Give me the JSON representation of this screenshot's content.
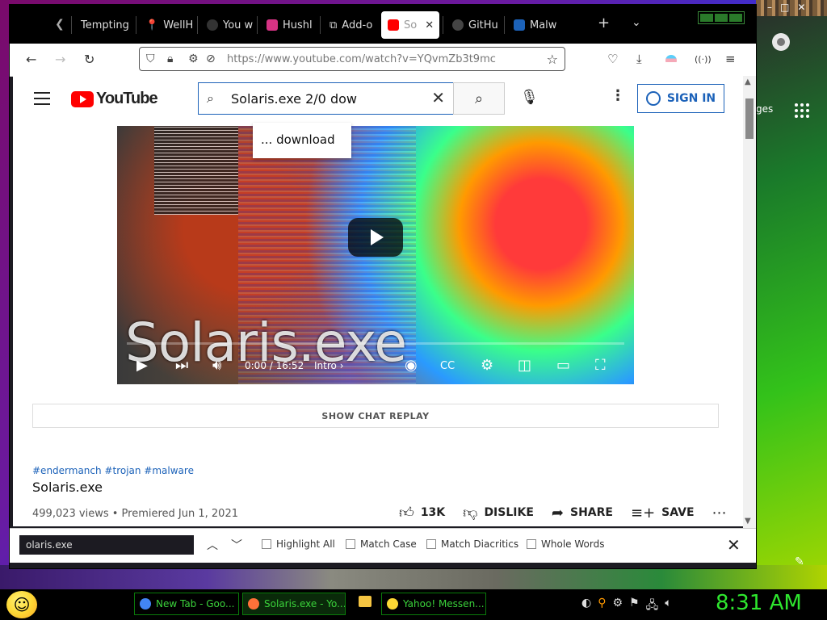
{
  "browser": {
    "tabs": [
      {
        "label": "Tempting",
        "active": false,
        "color": "#000000"
      },
      {
        "label": "WellH",
        "active": false,
        "color": "#555555"
      },
      {
        "label": "You w",
        "active": false,
        "color": "#333333"
      },
      {
        "label": "Hushl",
        "active": false,
        "color": "#d63384"
      },
      {
        "label": "Add-o",
        "active": false,
        "color": "#888888"
      },
      {
        "label": "So",
        "active": true,
        "color": "#ff0000"
      },
      {
        "label": "GitHu",
        "active": false,
        "color": "#444444"
      },
      {
        "label": "Malw",
        "active": false,
        "color": "#1c62b9"
      }
    ],
    "url": "https://www.youtube.com/watch?v=YQvmZb3t9mc"
  },
  "youtube": {
    "logo_text": "YouTube",
    "search_value": "Solaris.exe 2/0 dow",
    "suggestion": "... download",
    "sign_in_label": "SIGN IN",
    "player": {
      "overlay_title": "Solaris.exe",
      "time": "0:00 / 16:52",
      "chapter": "Intro",
      "progress": 0
    },
    "show_chat_replay": "SHOW CHAT REPLAY",
    "hashtags": "#endermanch #trojan #malware",
    "video_title": "Solaris.exe",
    "views": "499,023 views",
    "premiered": "Premiered Jun 1, 2021",
    "actions": {
      "like_count": "13K",
      "dislike": "DISLIKE",
      "share": "SHARE",
      "save": "SAVE"
    }
  },
  "findbar": {
    "query": "olaris.exe",
    "options": [
      "Highlight All",
      "Match Case",
      "Match Diacritics",
      "Whole Words"
    ]
  },
  "desktop": {
    "side_text": "ges"
  },
  "taskbar": {
    "tasks": [
      {
        "label": "New Tab - Goo...",
        "icon_color": "#4285f4"
      },
      {
        "label": "Solaris.exe - Yo...",
        "icon_color": "#ff7139"
      },
      {
        "label": "Yahoo! Messen...",
        "icon_color": "#fdd835"
      }
    ],
    "clock": "8:31 AM"
  }
}
